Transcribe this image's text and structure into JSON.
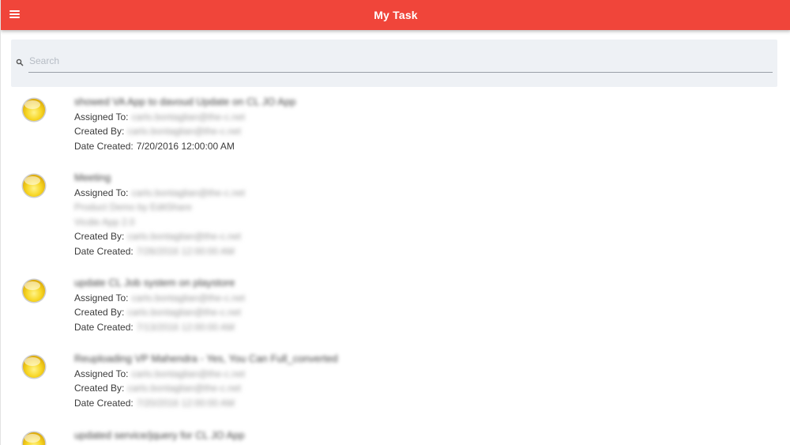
{
  "header": {
    "title": "My Task",
    "menu_icon": "hamburger-menu-icon",
    "bar_color": "#f0453a"
  },
  "search": {
    "placeholder": "Search",
    "value": "",
    "icon": "search-icon"
  },
  "labels": {
    "assigned_to": "Assigned To:",
    "created_by": "Created By:",
    "date_created": "Date Created:"
  },
  "tasks": [
    {
      "title": "showed VA App to davoud Update on CL JO App",
      "assigned_to": "carlo.bontaglian@the-c.net",
      "created_by": "carlo.bontaglian@the-c.net",
      "date_created": "7/20/2016 12:00:00 AM",
      "extra": []
    },
    {
      "title": "Meeting",
      "assigned_to": "carlo.bontaglian@the-c.net",
      "created_by": "carlo.bontaglian@the-c.net",
      "date_created": "7/26/2016 12:00:00 AM",
      "extra": [
        "Product Demo by EditShare",
        "Vicdie App 2.0"
      ]
    },
    {
      "title": "update CL Job system on playstore",
      "assigned_to": "carlo.bontaglian@the-c.net",
      "created_by": "carlo.bontaglian@the-c.net",
      "date_created": "7/13/2016 12:00:00 AM",
      "extra": []
    },
    {
      "title": "Reuploading VP Mahendra - Yes, You Can Full_converted",
      "assigned_to": "carlo.bontaglian@the-c.net",
      "created_by": "carlo.bontaglian@the-c.net",
      "date_created": "7/20/2016 12:00:00 AM",
      "extra": []
    },
    {
      "title": "updated service/jquery for CL JO App",
      "assigned_to": "",
      "created_by": "",
      "date_created": "",
      "extra": []
    }
  ],
  "status_icon": "yellow-status-circle-icon",
  "status_color": "#f5d21c"
}
